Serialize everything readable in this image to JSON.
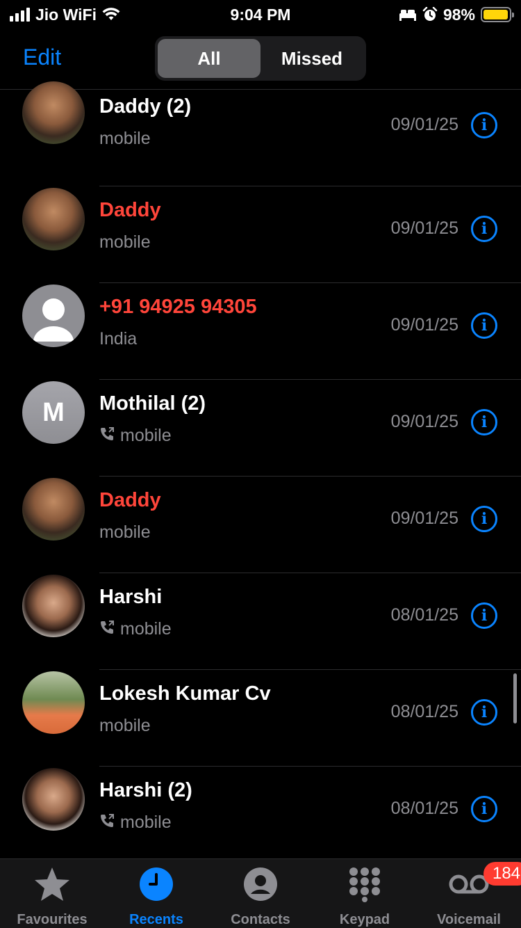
{
  "status_bar": {
    "carrier": "Jio WiFi",
    "time": "9:04 PM",
    "battery": "98%",
    "battery_level": 0.98,
    "icons": [
      "signal-icon",
      "wifi-icon",
      "bed-icon",
      "alarm-icon",
      "battery-icon"
    ]
  },
  "nav": {
    "edit_label": "Edit",
    "segments": [
      {
        "label": "All",
        "active": true
      },
      {
        "label": "Missed",
        "active": false
      }
    ]
  },
  "calls": [
    {
      "name": "Daddy (2)",
      "type": "mobile",
      "date": "09/01/25",
      "missed": false,
      "outgoing": false,
      "avatar": "photo-dad"
    },
    {
      "name": "Daddy",
      "type": "mobile",
      "date": "09/01/25",
      "missed": true,
      "outgoing": false,
      "avatar": "photo-dad"
    },
    {
      "name": "+91 94925 94305",
      "type": "India",
      "date": "09/01/25",
      "missed": true,
      "outgoing": false,
      "avatar": "generic-person"
    },
    {
      "name": "Mothilal (2)",
      "type": "mobile",
      "date": "09/01/25",
      "missed": false,
      "outgoing": true,
      "avatar": "letter",
      "initial": "M"
    },
    {
      "name": "Daddy",
      "type": "mobile",
      "date": "09/01/25",
      "missed": true,
      "outgoing": false,
      "avatar": "photo-dad"
    },
    {
      "name": "Harshi",
      "type": "mobile",
      "date": "08/01/25",
      "missed": false,
      "outgoing": true,
      "avatar": "photo-harshi"
    },
    {
      "name": "Lokesh Kumar Cv",
      "type": "mobile",
      "date": "08/01/25",
      "missed": false,
      "outgoing": false,
      "avatar": "photo-lokesh"
    },
    {
      "name": "Harshi (2)",
      "type": "mobile",
      "date": "08/01/25",
      "missed": false,
      "outgoing": true,
      "avatar": "photo-harshi"
    }
  ],
  "tabs": [
    {
      "label": "Favourites",
      "icon": "star-icon",
      "active": false
    },
    {
      "label": "Recents",
      "icon": "clock-icon",
      "active": true
    },
    {
      "label": "Contacts",
      "icon": "person-circle-icon",
      "active": false
    },
    {
      "label": "Keypad",
      "icon": "keypad-icon",
      "active": false
    },
    {
      "label": "Voicemail",
      "icon": "voicemail-icon",
      "active": false,
      "badge": "184"
    }
  ],
  "colors": {
    "accent": "#0a84ff",
    "missed": "#ff453a",
    "secondary_text": "#8e8e93",
    "battery": "#ffd60a"
  }
}
